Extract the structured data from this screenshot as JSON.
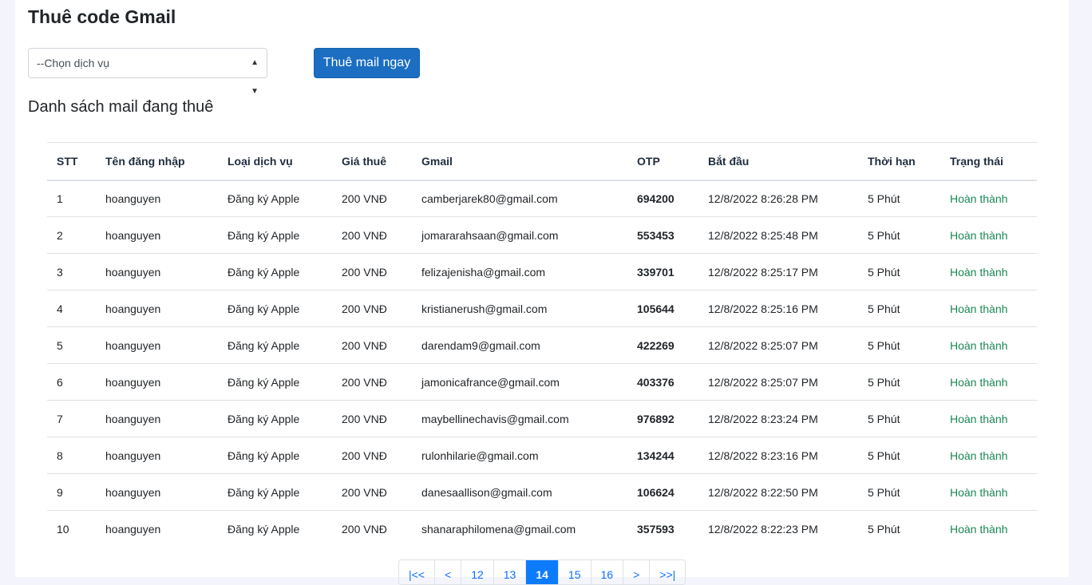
{
  "title": "Thuê code Gmail",
  "service_select": {
    "value": "--Chọn dịch vụ"
  },
  "rent_button": "Thuê mail ngay",
  "list_title": "Danh sách mail đang thuê",
  "columns": [
    "STT",
    "Tên đăng nhập",
    "Loại dịch vụ",
    "Giá thuê",
    "Gmail",
    "OTP",
    "Bắt đầu",
    "Thời hạn",
    "Trạng thái"
  ],
  "rows": [
    [
      "1",
      "hoanguyen",
      "Đăng ký Apple",
      "200 VNĐ",
      "camberjarek80@gmail.com",
      "694200",
      "12/8/2022 8:26:28 PM",
      "5 Phút",
      "Hoàn thành"
    ],
    [
      "2",
      "hoanguyen",
      "Đăng ký Apple",
      "200 VNĐ",
      "jomararahsaan@gmail.com",
      "553453",
      "12/8/2022 8:25:48 PM",
      "5 Phút",
      "Hoàn thành"
    ],
    [
      "3",
      "hoanguyen",
      "Đăng ký Apple",
      "200 VNĐ",
      "felizajenisha@gmail.com",
      "339701",
      "12/8/2022 8:25:17 PM",
      "5 Phút",
      "Hoàn thành"
    ],
    [
      "4",
      "hoanguyen",
      "Đăng ký Apple",
      "200 VNĐ",
      "kristianerush@gmail.com",
      "105644",
      "12/8/2022 8:25:16 PM",
      "5 Phút",
      "Hoàn thành"
    ],
    [
      "5",
      "hoanguyen",
      "Đăng ký Apple",
      "200 VNĐ",
      "darendam9@gmail.com",
      "422269",
      "12/8/2022 8:25:07 PM",
      "5 Phút",
      "Hoàn thành"
    ],
    [
      "6",
      "hoanguyen",
      "Đăng ký Apple",
      "200 VNĐ",
      "jamonicafrance@gmail.com",
      "403376",
      "12/8/2022 8:25:07 PM",
      "5 Phút",
      "Hoàn thành"
    ],
    [
      "7",
      "hoanguyen",
      "Đăng ký Apple",
      "200 VNĐ",
      "maybellinechavis@gmail.com",
      "976892",
      "12/8/2022 8:23:24 PM",
      "5 Phút",
      "Hoàn thành"
    ],
    [
      "8",
      "hoanguyen",
      "Đăng ký Apple",
      "200 VNĐ",
      "rulonhilarie@gmail.com",
      "134244",
      "12/8/2022 8:23:16 PM",
      "5 Phút",
      "Hoàn thành"
    ],
    [
      "9",
      "hoanguyen",
      "Đăng ký Apple",
      "200 VNĐ",
      "danesaallison@gmail.com",
      "106624",
      "12/8/2022 8:22:50 PM",
      "5 Phút",
      "Hoàn thành"
    ],
    [
      "10",
      "hoanguyen",
      "Đăng ký Apple",
      "200 VNĐ",
      "shanaraphilomena@gmail.com",
      "357593",
      "12/8/2022 8:22:23 PM",
      "5 Phút",
      "Hoàn thành"
    ]
  ],
  "pagination": {
    "items": [
      "|<<",
      "<",
      "12",
      "13",
      "14",
      "15",
      "16",
      ">",
      ">>|"
    ],
    "active": "14"
  }
}
